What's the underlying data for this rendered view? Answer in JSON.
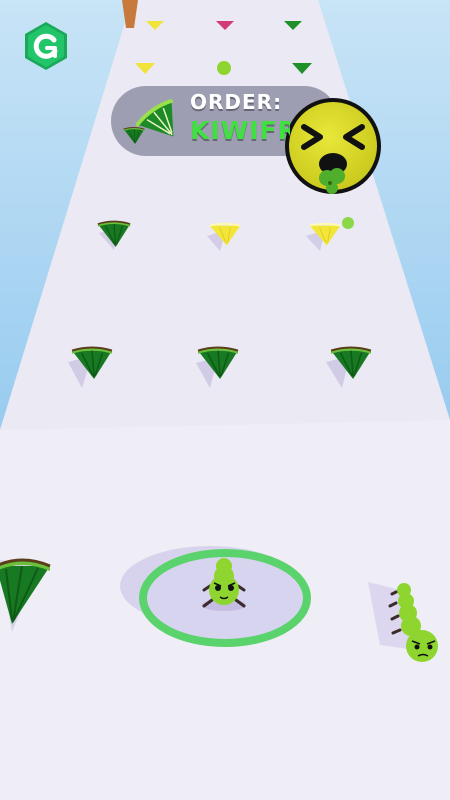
{
  "order": {
    "label": "ORDER:",
    "item": "KIWIFR"
  },
  "hud": {
    "restart_icon": "restart-icon"
  },
  "emoji": {
    "icon": "sick-face-icon"
  },
  "colors": {
    "sky": "#7fc4ee",
    "track": "#efedf6",
    "order_panel": "#9ea0b4",
    "kiwi_green": "#1f8f2a",
    "lemon_yellow": "#f4ea3c",
    "player_green": "#8ed62f",
    "ring_green": "#5ad36d",
    "emoji_yellow": "#d9d92b",
    "restart_green": "#1cc06a"
  }
}
